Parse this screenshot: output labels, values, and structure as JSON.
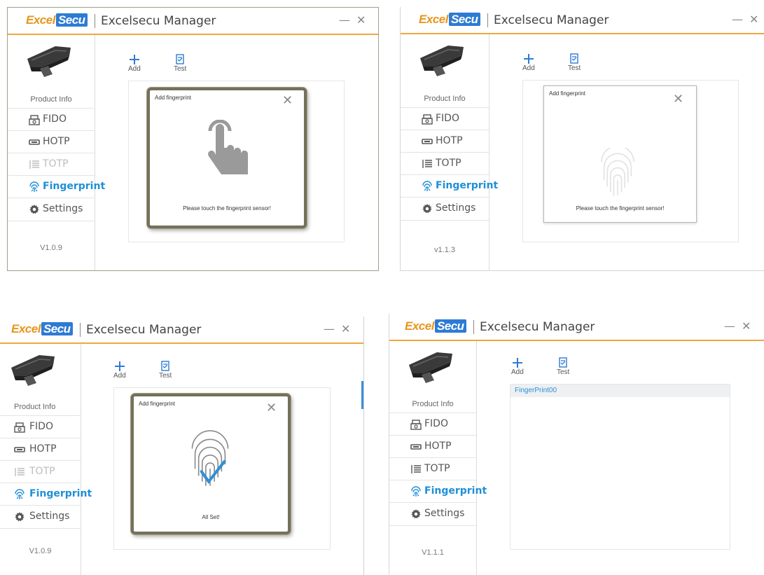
{
  "logo": {
    "part1": "Excel",
    "part2": "Secu"
  },
  "app_title": "Excelsecu Manager",
  "window_controls": {
    "minimize": "—",
    "close": "✕"
  },
  "sidebar": {
    "product_info": "Product Info",
    "items": [
      {
        "label": "FIDO",
        "icon": "fido-icon"
      },
      {
        "label": "HOTP",
        "icon": "hotp-icon"
      },
      {
        "label": "TOTP",
        "icon": "totp-icon"
      },
      {
        "label": "Fingerprint",
        "icon": "fingerprint-icon"
      },
      {
        "label": "Settings",
        "icon": "gear-icon"
      }
    ]
  },
  "toolbar": {
    "add": "Add",
    "test": "Test"
  },
  "accent_color": "#1f8fd6",
  "windows": [
    {
      "version": "V1.0.9",
      "dialog": {
        "title": "Add fingerprint",
        "close": "✕",
        "message": "Please touch the fingerprint sensor!",
        "graphic": "touch-hand-icon"
      }
    },
    {
      "version": "v1.1.3",
      "dialog": {
        "title": "Add fingerprint",
        "close": "✕",
        "message": "Please touch the fingerprint sensor!",
        "graphic": "fingerprint-scan-icon"
      }
    },
    {
      "version": "V1.0.9",
      "dialog": {
        "title": "Add fingerprint",
        "close": "✕",
        "message": "All Set!",
        "graphic": "fingerprint-check-icon"
      }
    },
    {
      "version": "V1.1.1",
      "list": [
        "FingerPrint00"
      ]
    }
  ]
}
